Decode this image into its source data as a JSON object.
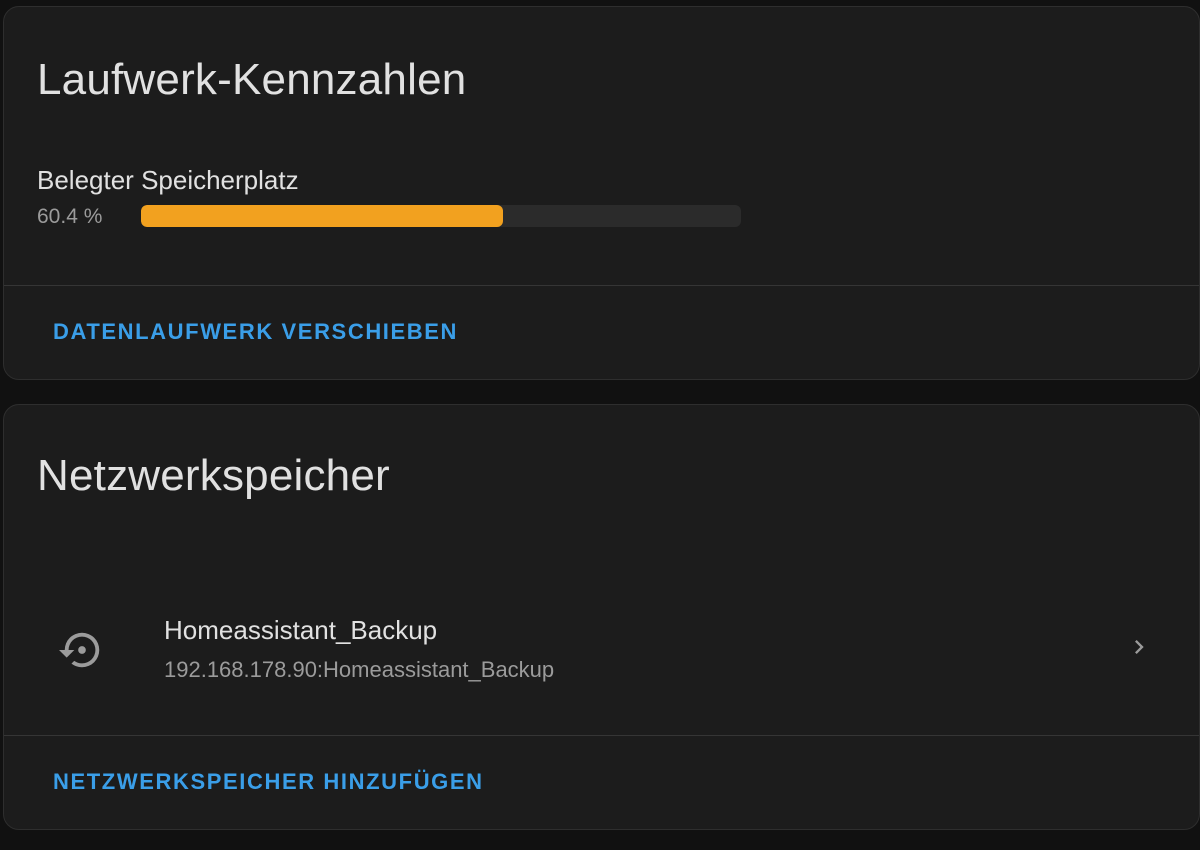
{
  "disk_metrics": {
    "title": "Laufwerk-Kennzahlen",
    "used_space_label": "Belegter Speicherplatz",
    "used_space_value": "60.4 %",
    "used_space_percent": 60.4,
    "progress_color": "#f2a11f",
    "move_button_label": "DATENLAUFWERK VERSCHIEBEN"
  },
  "network_storage": {
    "title": "Netzwerkspeicher",
    "mounts": [
      {
        "name": "Homeassistant_Backup",
        "path": "192.168.178.90:Homeassistant_Backup",
        "icon": "backup-restore-icon"
      }
    ],
    "add_button_label": "NETZWERKSPEICHER HINZUFÜGEN"
  },
  "theme": {
    "accent": "#3a9ee8",
    "card_background": "#1c1c1c",
    "page_background": "#111111"
  }
}
